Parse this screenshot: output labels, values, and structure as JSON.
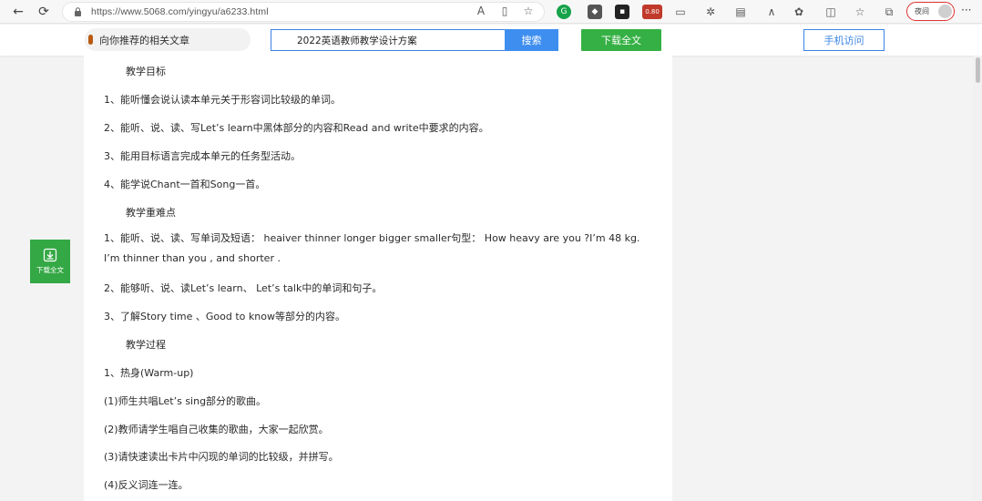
{
  "browser": {
    "url": "https://www.5068.com/yingyu/a6233.html",
    "profile_label": "夜间",
    "ext_badge": "0.80"
  },
  "site": {
    "related_label": "向你推荐的相关文章",
    "search_value": "2022英语教师教学设计方案",
    "search_button": "搜索",
    "download_button": "下载全文",
    "mobile_button": "手机访问",
    "float_download_label": "下载全文"
  },
  "article": {
    "lines": [
      "教学目标",
      "1、能听懂会说认读本单元关于形容词比较级的单词。",
      "2、能听、说、读、写Let’s learn中黑体部分的内容和Read and write中要求的内容。",
      "3、能用目标语言完成本单元的任务型活动。",
      "4、能学说Chant一首和Song一首。",
      "教学重难点",
      "1、能听、说、读、写单词及短语： heaiver thinner longer bigger smaller句型： How heavy are you ?I’m 48 kg. I’m thinner than you , and shorter .",
      "2、能够听、说、读Let’s learn、 Let’s talk中的单词和句子。",
      "3、了解Story time 、Good to know等部分的内容。",
      "教学过程",
      "1、热身(Warm-up)",
      "(1)师生共唱Let’s sing部分的歌曲。",
      "(2)教师请学生唱自己收集的歌曲，大家一起欣赏。",
      "(3)请快速读出卡片中闪现的单词的比较级，并拼写。",
      "(4)反义词连一连。"
    ]
  }
}
